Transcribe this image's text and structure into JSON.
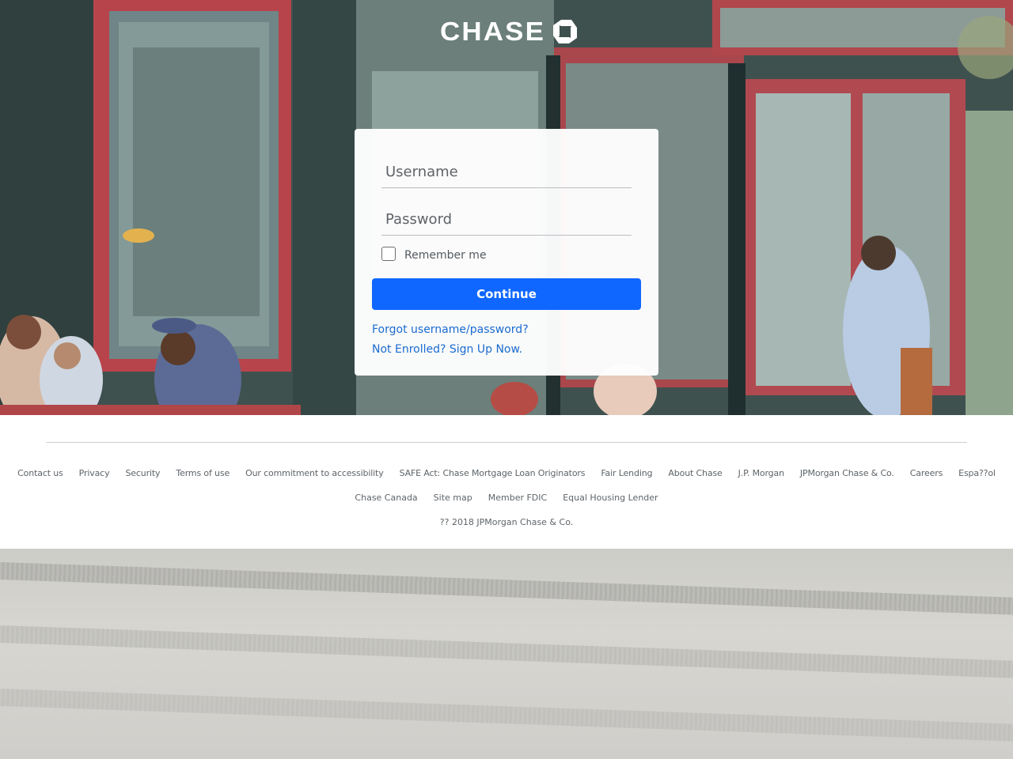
{
  "brand": {
    "name": "CHASE",
    "logo_icon": "chase-octagon-icon",
    "colors": {
      "primary_button": "#0f67ff",
      "link": "#1a6cd0"
    }
  },
  "login": {
    "username_placeholder": "Username",
    "password_placeholder": "Password",
    "remember_label": "Remember me",
    "continue_label": "Continue",
    "forgot_link": "Forgot username/password?",
    "enroll_link": "Not Enrolled? Sign Up Now."
  },
  "footer": {
    "row1": [
      "Contact us",
      "Privacy",
      "Security",
      "Terms of use",
      "Our commitment to accessibility",
      "SAFE Act: Chase Mortgage Loan Originators",
      "Fair Lending",
      "About Chase",
      "J.P. Morgan",
      "JPMorgan Chase & Co.",
      "Careers",
      "Espa??ol"
    ],
    "row2": [
      "Chase Canada",
      "Site map",
      "Member FDIC",
      "Equal Housing Lender"
    ],
    "copyright": "?? 2018 JPMorgan Chase & Co."
  }
}
